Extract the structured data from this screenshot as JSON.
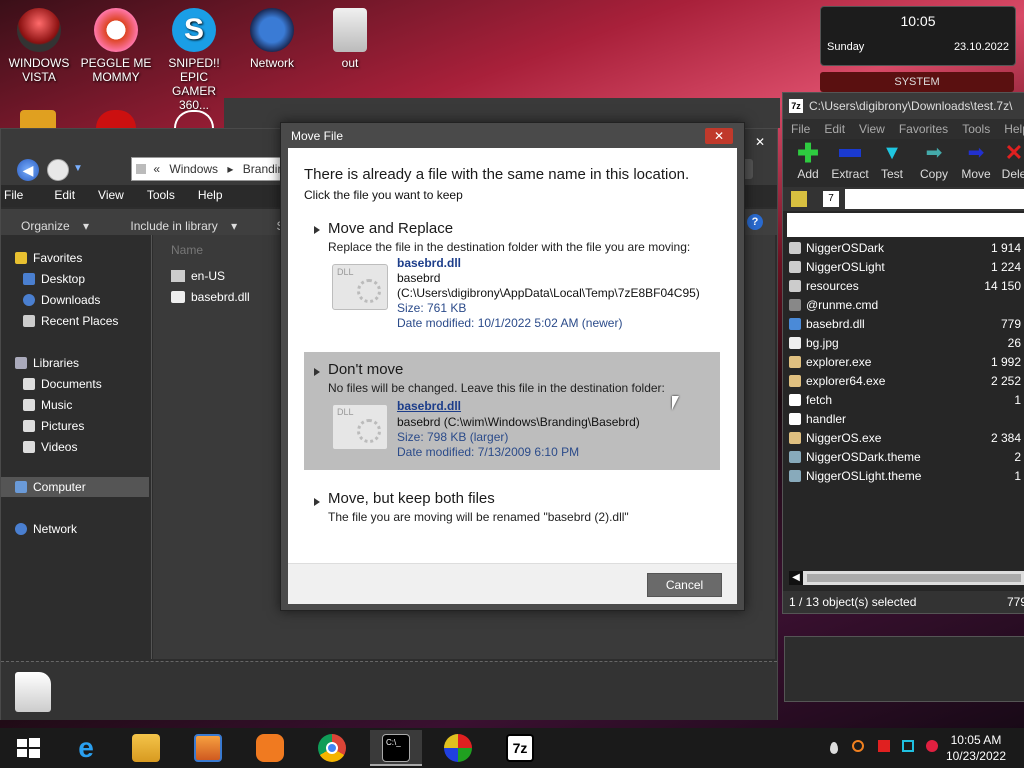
{
  "desktop": {
    "icons": [
      {
        "label1": "WINDOWS",
        "label2": "VISTA",
        "icon": "vista-icon"
      },
      {
        "label1": "PEGGLE ME",
        "label2": "MOMMY",
        "icon": "peggle-icon"
      },
      {
        "label1": "SNIPED!! EPIC",
        "label2": "GAMER 360...",
        "icon": "skype-icon"
      },
      {
        "label1": "Network",
        "label2": "",
        "icon": "network-icon"
      },
      {
        "label1": "out",
        "label2": "",
        "icon": "folder-icon"
      }
    ]
  },
  "gadget": {
    "time": "10:05",
    "day": "Sunday",
    "date": "23.10.2022",
    "label": "SYSTEM"
  },
  "explorer": {
    "address": {
      "chevron": "«",
      "crumb1": "Windows",
      "crumb2": "Brandin"
    },
    "menu": [
      "File",
      "Edit",
      "View",
      "Tools",
      "Help"
    ],
    "commands": {
      "organize": "Organize",
      "include": "Include in library",
      "share": "Share wi"
    },
    "nav": {
      "favorites": "Favorites",
      "desktop": "Desktop",
      "downloads": "Downloads",
      "recent": "Recent Places",
      "libraries": "Libraries",
      "documents": "Documents",
      "music": "Music",
      "pictures": "Pictures",
      "videos": "Videos",
      "computer": "Computer",
      "network": "Network"
    },
    "column_header": "Name",
    "files": [
      "en-US",
      "basebrd.dll"
    ]
  },
  "sevenzip": {
    "title": "C:\\Users\\digibrony\\Downloads\\test.7z\\",
    "menu": [
      "File",
      "Edit",
      "View",
      "Favorites",
      "Tools",
      "Help"
    ],
    "toolbar": [
      "Add",
      "Extract",
      "Test",
      "Copy",
      "Move",
      "Dele"
    ],
    "files": [
      {
        "name": "NiggerOSDark",
        "size": "1 914"
      },
      {
        "name": "NiggerOSLight",
        "size": "1 224"
      },
      {
        "name": "resources",
        "size": "14 150"
      },
      {
        "name": "@runme.cmd",
        "size": ""
      },
      {
        "name": "basebrd.dll",
        "size": "779"
      },
      {
        "name": "bg.jpg",
        "size": "26"
      },
      {
        "name": "explorer.exe",
        "size": "1 992"
      },
      {
        "name": "explorer64.exe",
        "size": "2 252"
      },
      {
        "name": "fetch",
        "size": "1"
      },
      {
        "name": "handler",
        "size": ""
      },
      {
        "name": "NiggerOS.exe",
        "size": "2 384"
      },
      {
        "name": "NiggerOSDark.theme",
        "size": "2"
      },
      {
        "name": "NiggerOSLight.theme",
        "size": "1"
      }
    ],
    "status": "1 / 13 object(s) selected",
    "status_right": "779"
  },
  "dialog": {
    "title": "Move File",
    "close": "✕",
    "heading": "There is already a file with the same name in this location.",
    "subheading": "Click the file you want to keep",
    "replace": {
      "title": "Move and Replace",
      "desc": "Replace the file in the destination folder with the file you are moving:",
      "filename": "basebrd.dll",
      "line2": "basebrd",
      "line3": "(C:\\Users\\digibrony\\AppData\\Local\\Temp\\7zE8BF04C95)",
      "size": "Size: 761 KB",
      "modified": "Date modified: 10/1/2022 5:02 AM (newer)"
    },
    "dont_move": {
      "title": "Don't move",
      "desc": "No files will be changed. Leave this file in the destination folder:",
      "filename": "basebrd.dll",
      "line2": "basebrd (C:\\wim\\Windows\\Branding\\Basebrd)",
      "size": "Size: 798 KB (larger)",
      "modified": "Date modified: 7/13/2009 6:10 PM"
    },
    "keep_both": {
      "title": "Move, but keep both files",
      "desc": "The file you are moving will be renamed \"basebrd (2).dll\""
    },
    "file_icon_label": "DLL",
    "cancel": "Cancel"
  },
  "taskbar": {
    "time": "10:05 AM",
    "date": "10/23/2022",
    "items": [
      "start-icon",
      "ie-icon",
      "explorer-icon",
      "media-player-icon",
      "uc-browser-icon",
      "chrome-icon",
      "cmd-icon",
      "game-icon",
      "sevenzip-icon"
    ]
  }
}
